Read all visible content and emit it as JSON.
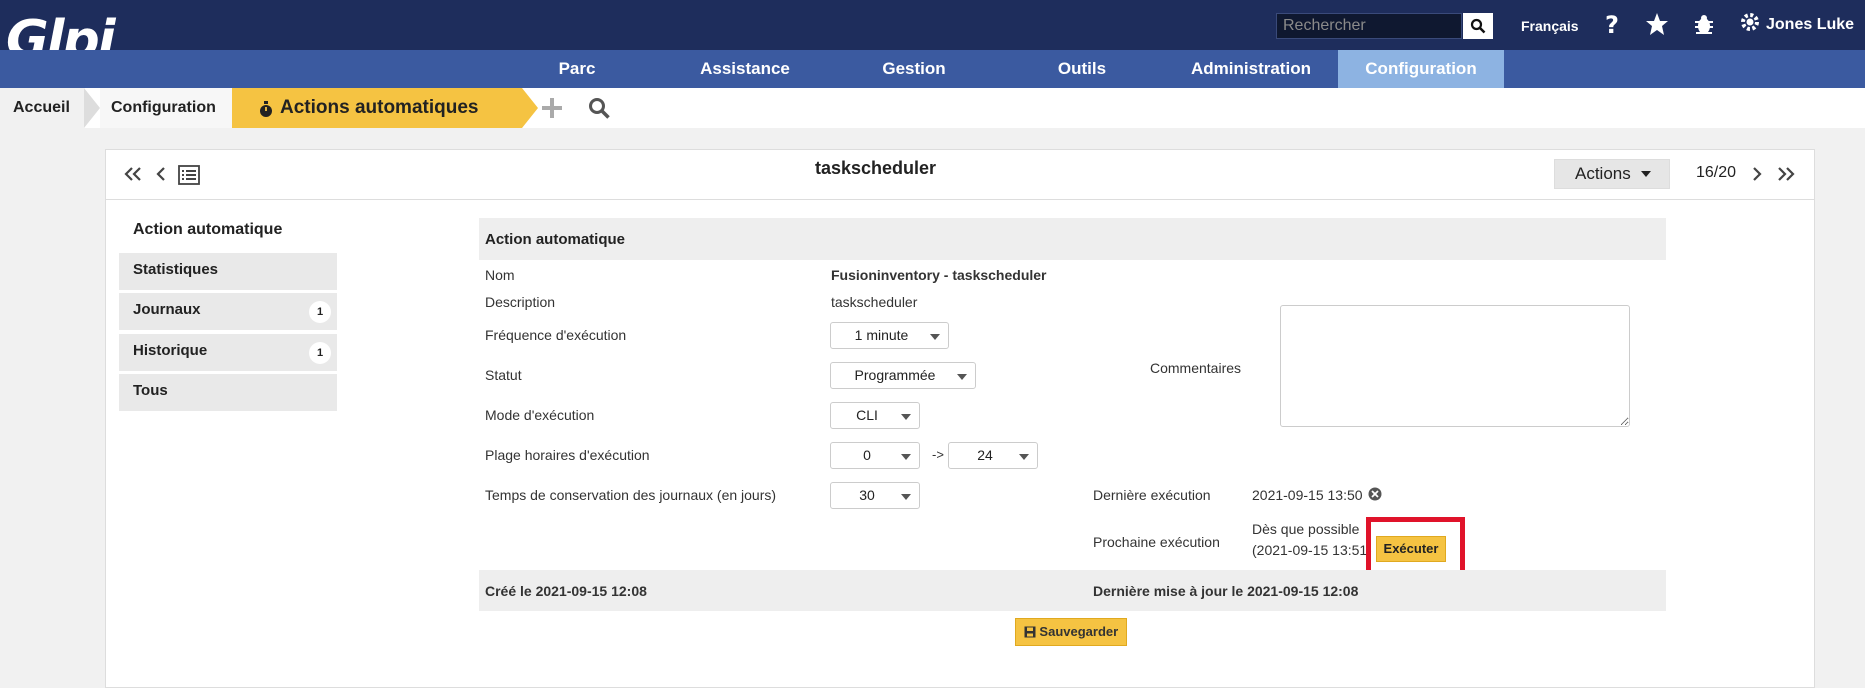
{
  "app": {
    "logo": "Glpi"
  },
  "topbar": {
    "search_placeholder": "Rechercher",
    "language": "Français",
    "user": "Jones Luke",
    "icons": [
      "search-icon",
      "help-icon",
      "star-icon",
      "bug-icon",
      "gear-icon"
    ]
  },
  "nav": [
    "Parc",
    "Assistance",
    "Gestion",
    "Outils",
    "Administration",
    "Configuration"
  ],
  "breadcrumb": {
    "home": "Accueil",
    "config": "Configuration",
    "current": "Actions automatiques"
  },
  "header": {
    "title": "taskscheduler",
    "actions": "Actions",
    "pager": "16/20"
  },
  "sidebar": {
    "title": "Action automatique",
    "tabs": [
      {
        "label": "Statistiques",
        "badge": ""
      },
      {
        "label": "Journaux",
        "badge": "1"
      },
      {
        "label": "Historique",
        "badge": "1"
      },
      {
        "label": "Tous",
        "badge": ""
      }
    ]
  },
  "form": {
    "section_title": "Action automatique",
    "nom_label": "Nom",
    "nom_value": "Fusioninventory - taskscheduler",
    "desc_label": "Description",
    "desc_value": "taskscheduler",
    "freq_label": "Fréquence d'exécution",
    "freq_value": "1 minute",
    "statut_label": "Statut",
    "statut_value": "Programmée",
    "mode_label": "Mode d'exécution",
    "mode_value": "CLI",
    "plage_label": "Plage horaires d'exécution",
    "plage_from": "0",
    "plage_arrow": "->",
    "plage_to": "24",
    "temps_label": "Temps de conservation des journaux (en jours)",
    "temps_value": "30",
    "comments_label": "Commentaires",
    "derniere_label": "Dernière exécution",
    "derniere_value": "2021-09-15 13:50",
    "prochaine_label": "Prochaine exécution",
    "prochaine_line1": "Dès que possible",
    "prochaine_line2": "(2021-09-15 13:51)",
    "exec_button": "Exécuter",
    "created": "Créé le 2021-09-15 12:08",
    "updated": "Dernière mise à jour le 2021-09-15 12:08",
    "save_button": "Sauvegarder"
  },
  "colors": {
    "navy": "#1e2d5c",
    "nav": "#3b5aa0",
    "active_nav": "#8db3e2",
    "accent": "#f5c342",
    "highlight": "#e0132a"
  }
}
